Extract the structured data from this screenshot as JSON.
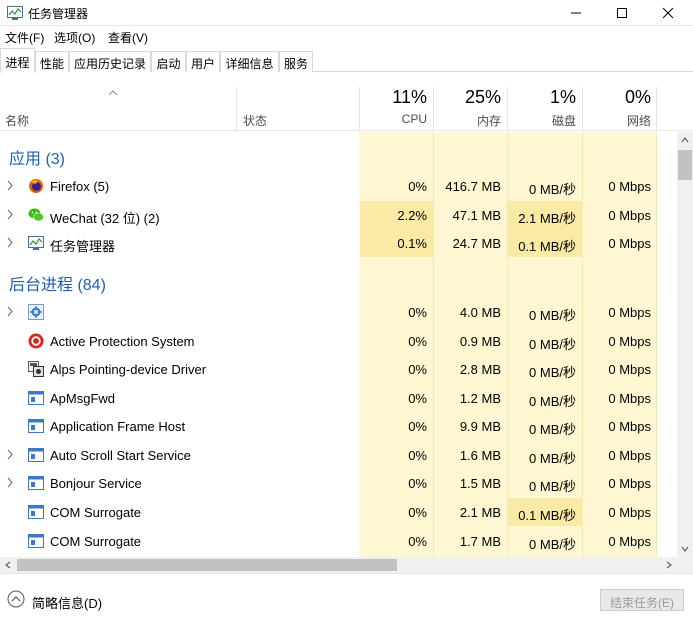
{
  "window": {
    "title": "任务管理器"
  },
  "menu": [
    "文件(F)",
    "选项(O)",
    "查看(V)"
  ],
  "tabs": [
    "进程",
    "性能",
    "应用历史记录",
    "启动",
    "用户",
    "详细信息",
    "服务"
  ],
  "columns": {
    "name": "名称",
    "status": "状态",
    "cpu": {
      "pct": "11%",
      "label": "CPU"
    },
    "mem": {
      "pct": "25%",
      "label": "内存"
    },
    "disk": {
      "pct": "1%",
      "label": "磁盘"
    },
    "net": {
      "pct": "0%",
      "label": "网络"
    }
  },
  "groups": {
    "apps": "应用 (3)",
    "background": "后台进程 (84)"
  },
  "apps": [
    {
      "name": "Firefox (5)",
      "cpu": "0%",
      "mem": "416.7 MB",
      "disk": "0 MB/秒",
      "net": "0 Mbps",
      "icon": "firefox-icon"
    },
    {
      "name": "WeChat (32 位) (2)",
      "cpu": "2.2%",
      "mem": "47.1 MB",
      "disk": "2.1 MB/秒",
      "net": "0 Mbps",
      "icon": "wechat-icon"
    },
    {
      "name": "任务管理器",
      "cpu": "0.1%",
      "mem": "24.7 MB",
      "disk": "0.1 MB/秒",
      "net": "0 Mbps",
      "icon": "task-manager-icon"
    }
  ],
  "background": [
    {
      "name": "",
      "cpu": "0%",
      "mem": "4.0 MB",
      "disk": "0 MB/秒",
      "net": "0 Mbps",
      "icon": "gear-icon"
    },
    {
      "name": "Active Protection System",
      "cpu": "0%",
      "mem": "0.9 MB",
      "disk": "0 MB/秒",
      "net": "0 Mbps",
      "icon": "protection-icon"
    },
    {
      "name": "Alps Pointing-device Driver",
      "cpu": "0%",
      "mem": "2.8 MB",
      "disk": "0 MB/秒",
      "net": "0 Mbps",
      "icon": "driver-icon"
    },
    {
      "name": "ApMsgFwd",
      "cpu": "0%",
      "mem": "1.2 MB",
      "disk": "0 MB/秒",
      "net": "0 Mbps",
      "icon": "window-icon"
    },
    {
      "name": "Application Frame Host",
      "cpu": "0%",
      "mem": "9.9 MB",
      "disk": "0 MB/秒",
      "net": "0 Mbps",
      "icon": "window-icon"
    },
    {
      "name": "Auto Scroll Start Service",
      "cpu": "0%",
      "mem": "1.6 MB",
      "disk": "0 MB/秒",
      "net": "0 Mbps",
      "icon": "window-icon"
    },
    {
      "name": "Bonjour Service",
      "cpu": "0%",
      "mem": "1.5 MB",
      "disk": "0 MB/秒",
      "net": "0 Mbps",
      "icon": "window-icon"
    },
    {
      "name": "COM Surrogate",
      "cpu": "0%",
      "mem": "2.1 MB",
      "disk": "0.1 MB/秒",
      "net": "0 Mbps",
      "icon": "window-icon"
    },
    {
      "name": "COM Surrogate",
      "cpu": "0%",
      "mem": "1.7 MB",
      "disk": "0 MB/秒",
      "net": "0 Mbps",
      "icon": "window-icon"
    }
  ],
  "footer": {
    "fewer_details": "简略信息(D)",
    "end_task": "结束任务(E)"
  },
  "colors": {
    "accent": "#1f5fad",
    "heat_low": "#fff7d1",
    "heat_mid": "#fbe9a6"
  }
}
